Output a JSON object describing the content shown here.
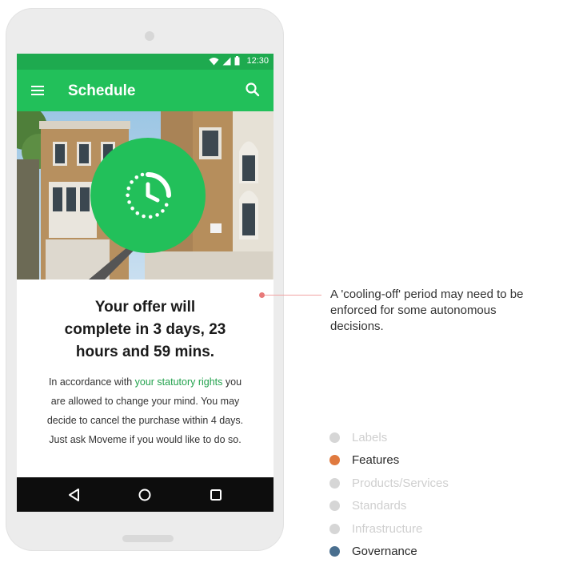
{
  "statusbar": {
    "time": "12:30"
  },
  "appbar": {
    "title": "Schedule"
  },
  "offer": {
    "headline_lines": [
      "Your offer will",
      "complete in 3 days, 23",
      "hours and 59 mins."
    ],
    "body_line1_prefix": "In accordance with ",
    "body_link": "your statutory rights",
    "body_line1_suffix": " you",
    "body_line2": "are allowed to change your mind. You may",
    "body_line3": "decide to cancel the purchase within 4 days.",
    "body_line4": "Just ask Moveme if you would like to do so."
  },
  "annotation": {
    "lines": [
      "A 'cooling-off' period may need to be",
      "enforced for some autonomous",
      "decisions."
    ]
  },
  "legend": [
    {
      "label": "Labels",
      "color": "#d6d6d6",
      "active": false
    },
    {
      "label": "Features",
      "color": "#e07a3f",
      "active": true
    },
    {
      "label": "Products/Services",
      "color": "#d6d6d6",
      "active": false
    },
    {
      "label": "Standards",
      "color": "#d6d6d6",
      "active": false
    },
    {
      "label": "Infrastructure",
      "color": "#d6d6d6",
      "active": false
    },
    {
      "label": "Governance",
      "color": "#4a6f8f",
      "active": true
    }
  ],
  "colors": {
    "brand": "#22c05a",
    "statusbar": "#1eaa4f",
    "link": "#22a24d"
  },
  "icons": {
    "appbar": [
      "menu-icon",
      "search-icon"
    ],
    "status": [
      "wifi-icon",
      "signal-icon",
      "battery-icon"
    ],
    "hero": "timer-icon",
    "navbar": [
      "back-icon",
      "home-icon",
      "recents-icon"
    ]
  }
}
